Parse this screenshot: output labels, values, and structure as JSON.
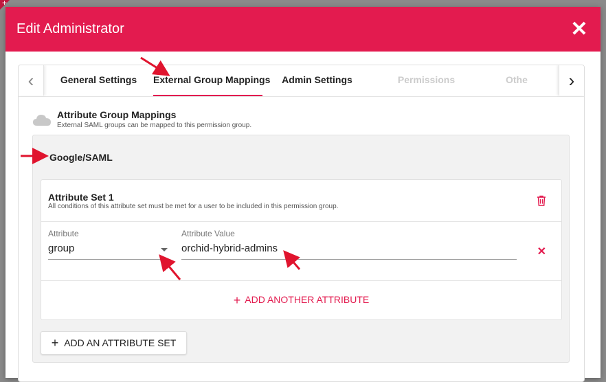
{
  "modal": {
    "title": "Edit Administrator",
    "close_glyph": "✕"
  },
  "corner": {
    "glyph": "+"
  },
  "tabs": {
    "items": [
      {
        "label": "General Settings",
        "state": "normal"
      },
      {
        "label": "External Group Mappings",
        "state": "active"
      },
      {
        "label": "Admin Settings",
        "state": "normal"
      },
      {
        "label": "Permissions",
        "state": "disabled"
      },
      {
        "label": "Othe",
        "state": "disabled"
      }
    ],
    "prev_glyph": "‹",
    "next_glyph": "›"
  },
  "section": {
    "title": "Attribute Group Mappings",
    "subtitle": "External SAML groups can be mapped to this permission group."
  },
  "provider": {
    "title": "Google/SAML"
  },
  "attribute_set": {
    "title": "Attribute Set 1",
    "subtitle": "All conditions of this attribute set must be met for a user to be included in this permission group.",
    "attribute_label": "Attribute",
    "attribute_value": "group",
    "value_label": "Attribute Value",
    "value_value": "orchid-hybrid-admins",
    "remove_glyph": "✕",
    "add_attribute_label": "ADD ANOTHER ATTRIBUTE"
  },
  "add_set": {
    "label": "ADD AN ATTRIBUTE SET",
    "plus_glyph": "+"
  },
  "colors": {
    "accent": "#e31b4f",
    "annotation": "#e0142e"
  }
}
